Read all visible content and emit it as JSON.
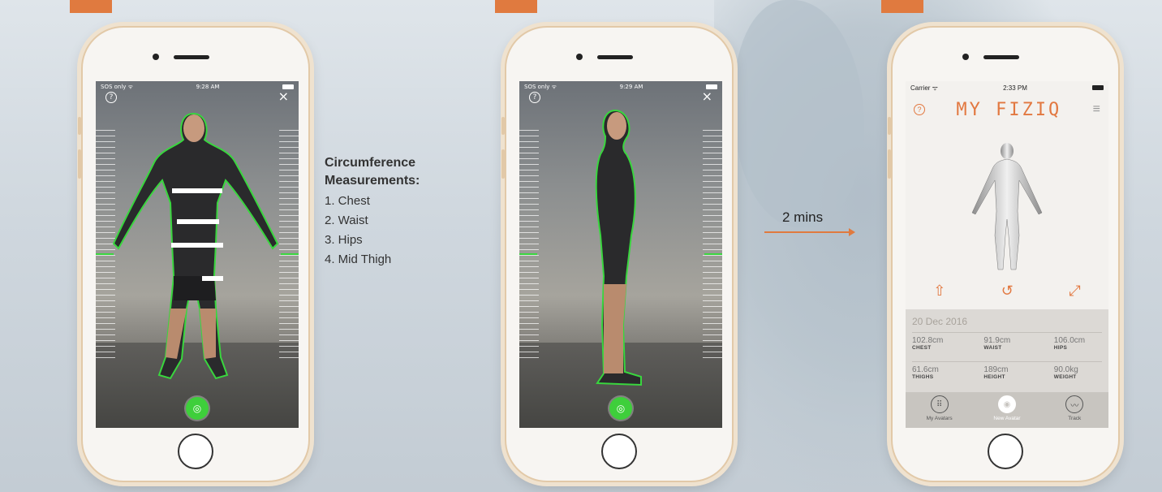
{
  "caption": {
    "title_line1": "Circumference",
    "title_line2": "Measurements:",
    "items": [
      "1. Chest",
      "2. Waist",
      "3. Hips",
      "4. Mid Thigh"
    ]
  },
  "transition": {
    "label": "2 mins"
  },
  "phone1": {
    "status_left": "SOS only ᯤ",
    "status_time": "9:28 AM",
    "help": "?",
    "close": "×"
  },
  "phone2": {
    "status_left": "SOS only ᯤ",
    "status_time": "9:29 AM",
    "help": "?",
    "close": "×"
  },
  "app": {
    "status_left": "Carrier ᯤ",
    "status_time": "2:33 PM",
    "help": "?",
    "logo": "MY FIZIQ",
    "menu": "≡",
    "date": "20 Dec 2016",
    "metrics": [
      [
        {
          "value": "102.8cm",
          "label": "CHEST"
        },
        {
          "value": "91.9cm",
          "label": "WAIST"
        },
        {
          "value": "106.0cm",
          "label": "HIPS"
        }
      ],
      [
        {
          "value": "61.6cm",
          "label": "THIGHS"
        },
        {
          "value": "189cm",
          "label": "HEIGHT"
        },
        {
          "value": "90.0kg",
          "label": "WEIGHT"
        }
      ]
    ],
    "tabs": [
      {
        "label": "My Avatars",
        "icon": "grid-icon",
        "glyph": "⠿",
        "active": false
      },
      {
        "label": "New Avatar",
        "icon": "person-icon",
        "glyph": "◉",
        "active": true
      },
      {
        "label": "Track",
        "icon": "chart-icon",
        "glyph": "〰",
        "active": false
      }
    ]
  },
  "colors": {
    "accent": "#e07a3f",
    "outline_green": "#39d63e"
  }
}
